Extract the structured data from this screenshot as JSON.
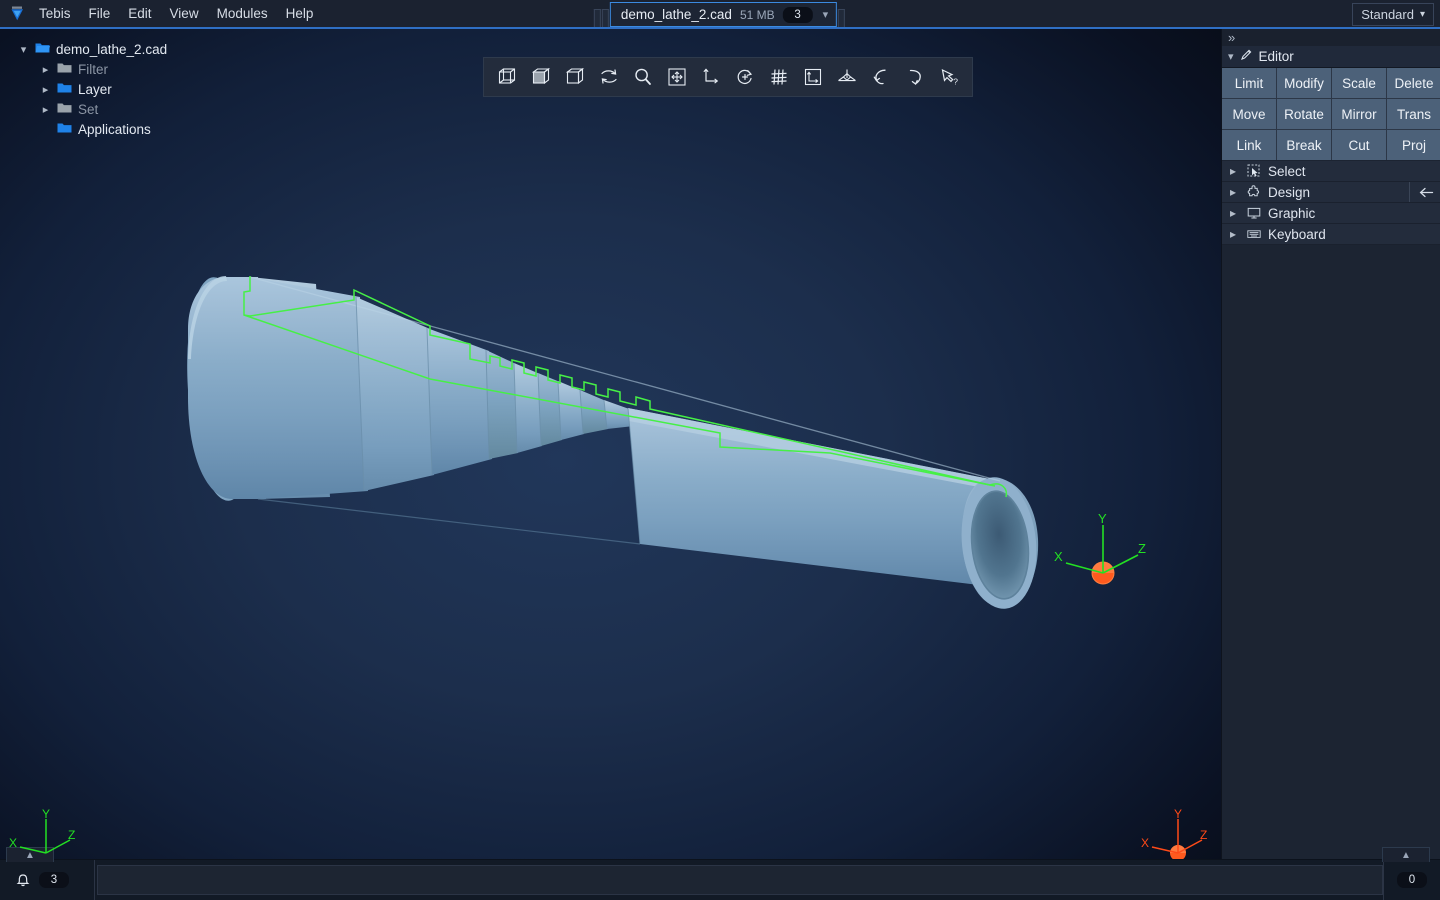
{
  "app": {
    "name": "Tebis",
    "logo_icon": "tebis-logo-icon"
  },
  "menubar": {
    "items": [
      {
        "label": "Tebis"
      },
      {
        "label": "File"
      },
      {
        "label": "Edit"
      },
      {
        "label": "View"
      },
      {
        "label": "Modules"
      },
      {
        "label": "Help"
      }
    ]
  },
  "document_tab": {
    "filename": "demo_lathe_2.cad",
    "filesize": "51 MB",
    "badge": "3",
    "chevron_icon": "chevron-down-icon"
  },
  "profile": {
    "label": "Standard",
    "chevron_icon": "chevron-down-icon"
  },
  "tree": {
    "root": {
      "label": "demo_lathe_2.cad",
      "chevron_icon": "chevron-down-icon",
      "folder_icon": "folder-open-icon"
    },
    "children": [
      {
        "label": "Filter",
        "chevron_icon": "chevron-right-icon",
        "folder_icon": "folder-icon",
        "dimmed": true
      },
      {
        "label": "Layer",
        "chevron_icon": "chevron-right-icon",
        "folder_icon": "folder-icon",
        "dimmed": false
      },
      {
        "label": "Set",
        "chevron_icon": "chevron-right-icon",
        "folder_icon": "folder-icon",
        "dimmed": true
      },
      {
        "label": "Applications",
        "chevron_icon": "",
        "folder_icon": "folder-icon",
        "dimmed": false
      }
    ]
  },
  "toolbar": {
    "buttons": [
      {
        "name": "wireframe-view-icon",
        "title": "Wireframe"
      },
      {
        "name": "shaded-view-icon",
        "title": "Shaded"
      },
      {
        "name": "solid-view-icon",
        "title": "Solid"
      },
      {
        "name": "refresh-swap-icon",
        "title": "Swap / Refresh"
      },
      {
        "name": "zoom-magnifier-icon",
        "title": "Zoom"
      },
      {
        "name": "pan-move-icon",
        "title": "Pan"
      },
      {
        "name": "coordinate-axis-icon",
        "title": "Coordinate system"
      },
      {
        "name": "rotate-view-icon",
        "title": "Rotate"
      },
      {
        "name": "grid-icon",
        "title": "Grid"
      },
      {
        "name": "frame-region-icon",
        "title": "Frame region"
      },
      {
        "name": "viewpoint-icon",
        "title": "View point"
      },
      {
        "name": "rotate-left-icon",
        "title": "Rotate left"
      },
      {
        "name": "rotate-down-icon",
        "title": "Rotate down"
      },
      {
        "name": "cursor-help-icon",
        "title": "Context help"
      }
    ]
  },
  "right_panel": {
    "expander_icon": "chevrons-right-icon",
    "header": {
      "label": "Editor",
      "chevron_icon": "chevron-down-icon",
      "icon": "pencil-icon"
    },
    "buttons": [
      "Limit",
      "Modify",
      "Scale",
      "Delete",
      "Move",
      "Rotate",
      "Mirror",
      "Trans",
      "Link",
      "Break",
      "Cut",
      "Proj"
    ],
    "sections": [
      {
        "label": "Select",
        "icon": "marquee-select-icon",
        "chevron_icon": "chevron-right-icon",
        "has_arrow": false
      },
      {
        "label": "Design",
        "icon": "puzzle-piece-icon",
        "chevron_icon": "chevron-right-icon",
        "has_arrow": true,
        "arrow_icon": "arrow-left-icon"
      },
      {
        "label": "Graphic",
        "icon": "monitor-icon",
        "chevron_icon": "chevron-right-icon",
        "has_arrow": false
      },
      {
        "label": "Keyboard",
        "icon": "keyboard-icon",
        "chevron_icon": "chevron-right-icon",
        "has_arrow": false
      }
    ]
  },
  "viewport": {
    "model_name": "demo_lathe_2",
    "contour_color": "#46f046",
    "surface_color": "#8fb0cc",
    "background_center": "#21375a",
    "background_edge": "#070b13",
    "triads": [
      {
        "name": "model-axis-triad",
        "labels": {
          "x": "X",
          "y": "Y",
          "z": "Z"
        },
        "color": "#23e023",
        "origin_marker": "sphere",
        "origin_color": "#ff5a1e"
      },
      {
        "name": "world-axis-triad",
        "labels": {
          "x": "X",
          "y": "Y",
          "z": "Z"
        },
        "color": "#23e023",
        "origin_marker": "none",
        "origin_color": ""
      },
      {
        "name": "reference-axis-triad",
        "labels": {
          "x": "X",
          "y": "Y",
          "z": "Z"
        },
        "color": "#ff4a18",
        "origin_marker": "sphere",
        "origin_color": "#ff5a1e"
      }
    ]
  },
  "statusbar": {
    "left_handle_icon": "chevron-up-icon",
    "right_handle_icon": "chevron-up-icon",
    "bell_icon": "bell-icon",
    "notification_count": "3",
    "right_count": "0",
    "input_value": "",
    "input_placeholder": ""
  }
}
